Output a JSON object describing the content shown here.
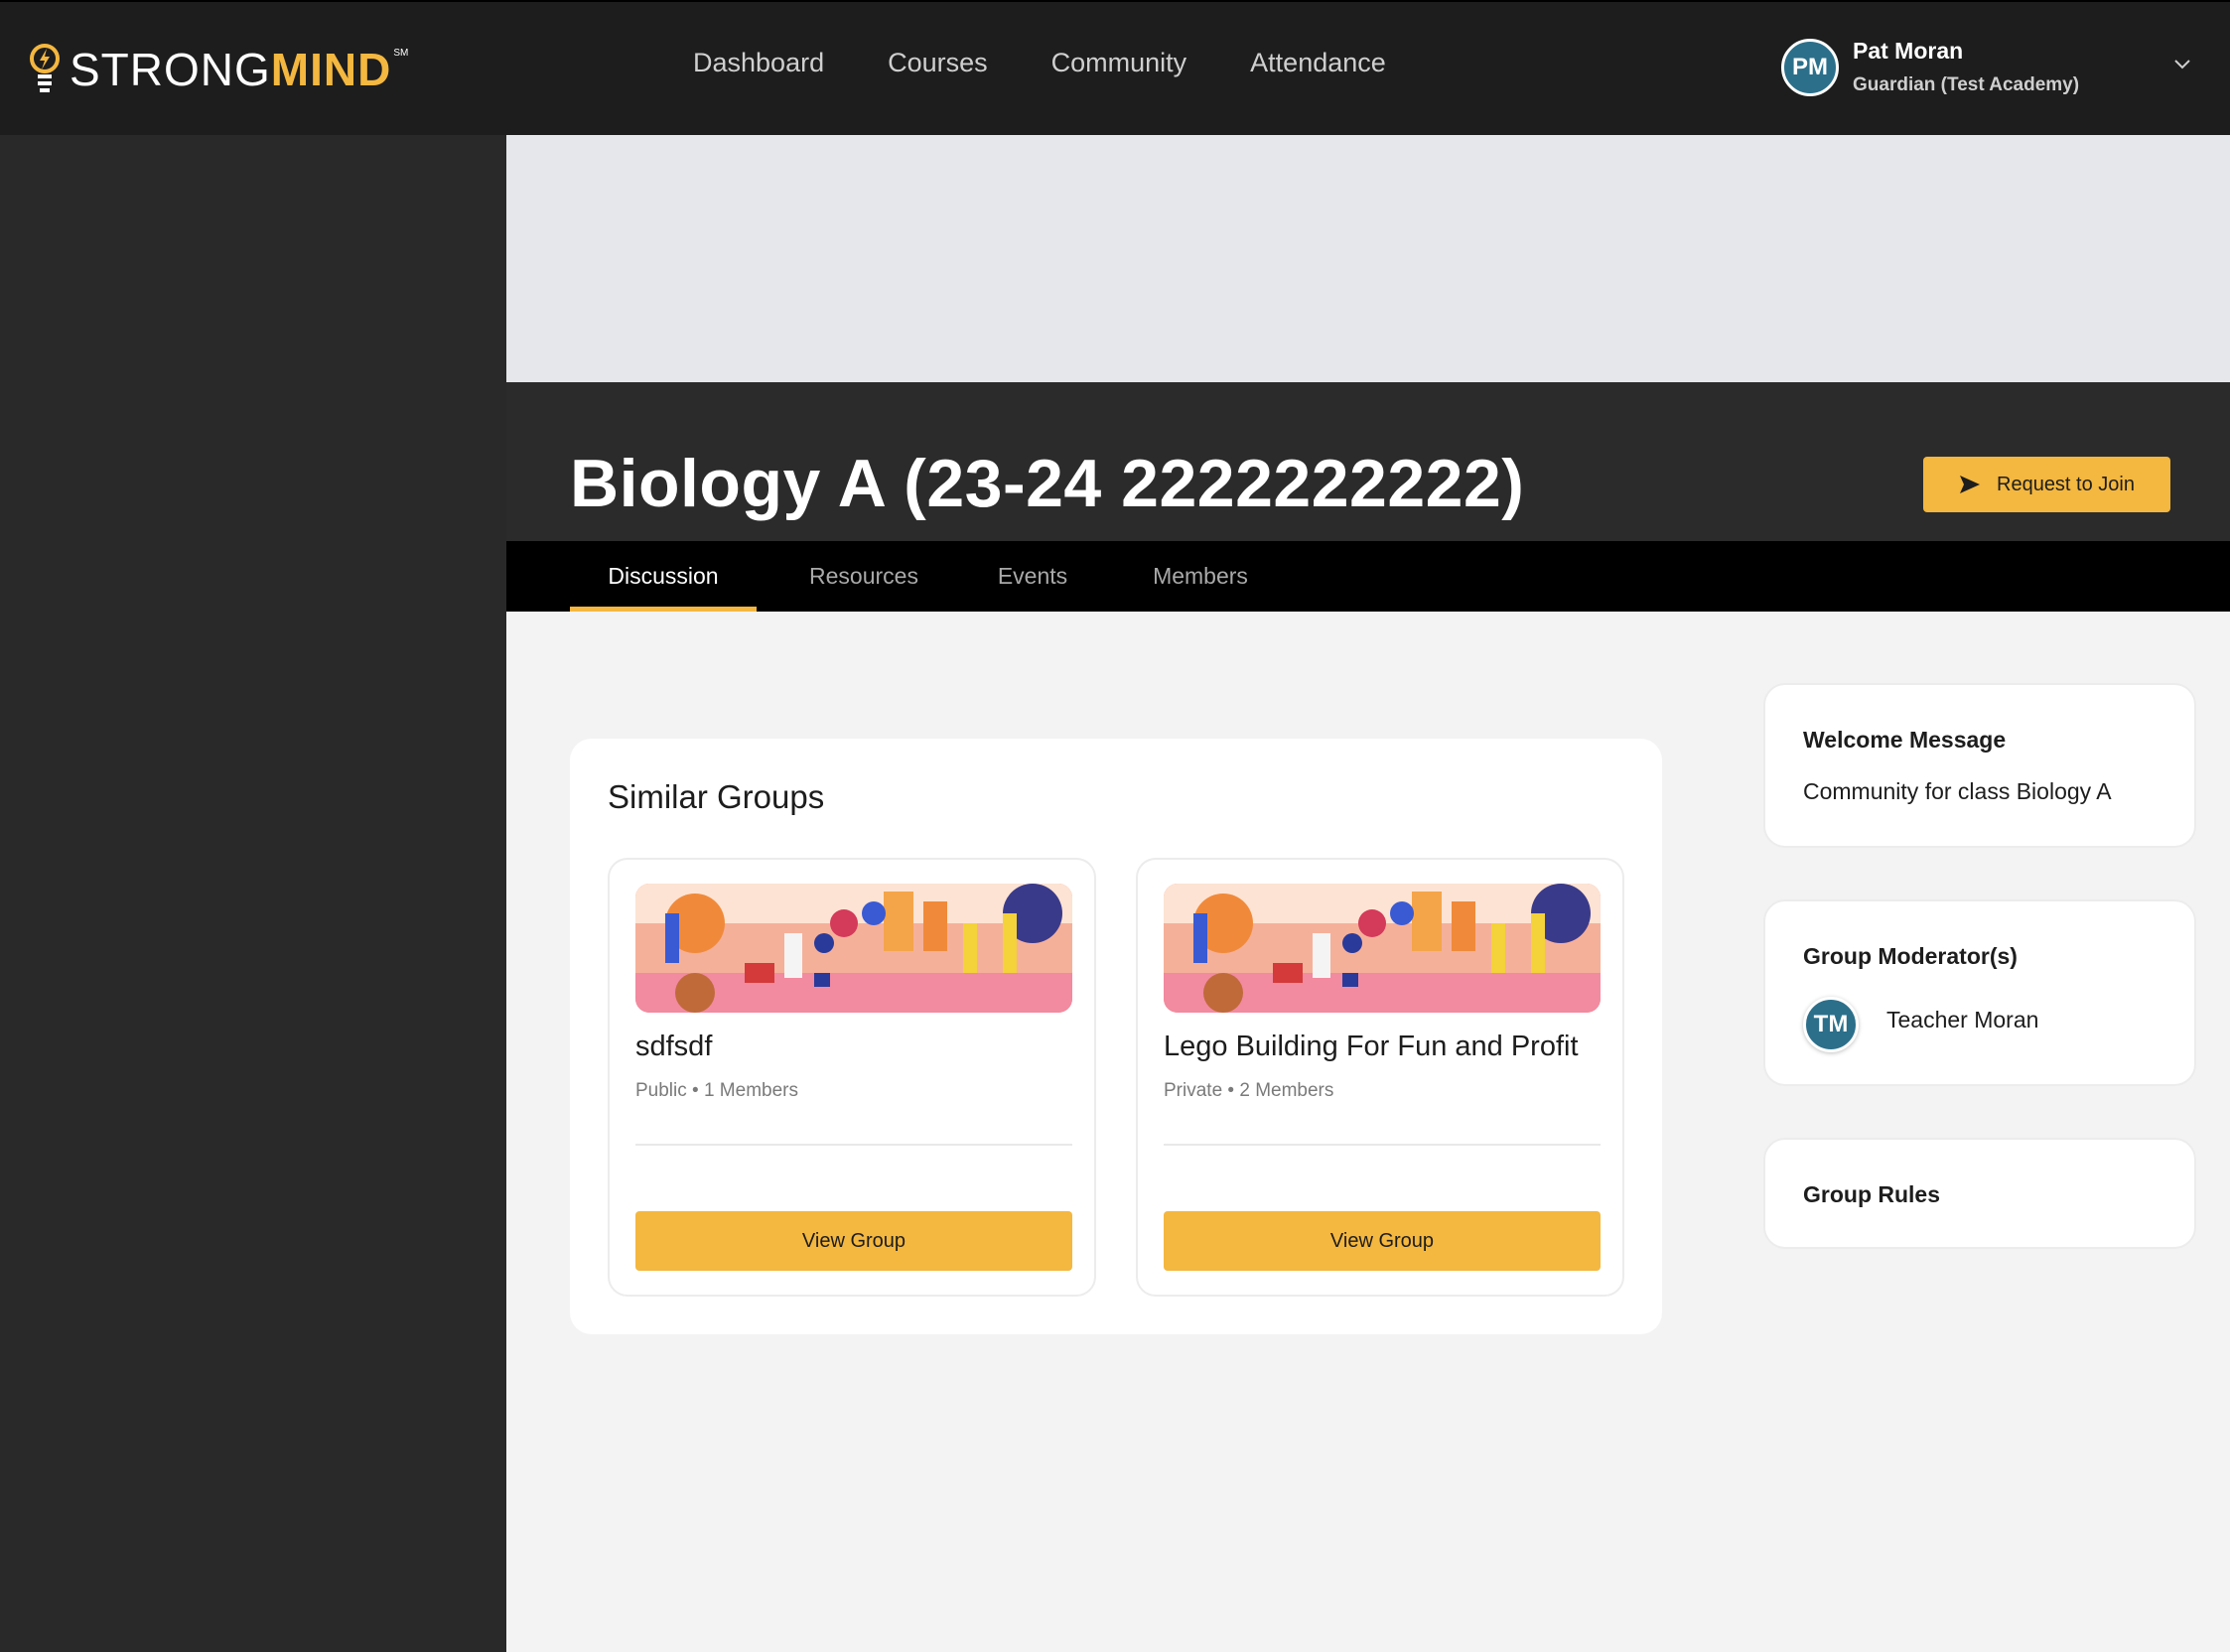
{
  "brand": {
    "logo_strong": "STRONG",
    "logo_mind": "MIND",
    "logo_sm": "SM"
  },
  "nav": {
    "items": [
      {
        "label": "Dashboard"
      },
      {
        "label": "Courses"
      },
      {
        "label": "Community"
      },
      {
        "label": "Attendance"
      }
    ]
  },
  "user": {
    "initials": "PM",
    "name": "Pat Moran",
    "role": "Guardian (Test Academy)"
  },
  "group": {
    "title": "Biology A (23-24 2222222222)",
    "join_label": "Request to Join"
  },
  "tabs": [
    {
      "label": "Discussion",
      "active": true
    },
    {
      "label": "Resources",
      "active": false
    },
    {
      "label": "Events",
      "active": false
    },
    {
      "label": "Members",
      "active": false
    }
  ],
  "similar_groups": {
    "title": "Similar Groups",
    "cards": [
      {
        "name": "sdfsdf",
        "meta": "Public • 1 Members",
        "button": "View Group"
      },
      {
        "name": "Lego Building For Fun and Profit",
        "meta": "Private • 2 Members",
        "button": "View Group"
      }
    ]
  },
  "welcome": {
    "title": "Welcome Message",
    "text": "Community for class Biology A"
  },
  "moderators": {
    "title": "Group Moderator(s)",
    "initials": "TM",
    "name": "Teacher Moran"
  },
  "rules": {
    "title": "Group Rules"
  },
  "colors": {
    "accent": "#f4b73f",
    "topbar": "#1d1d1d",
    "avatar": "#2c6f8a"
  }
}
